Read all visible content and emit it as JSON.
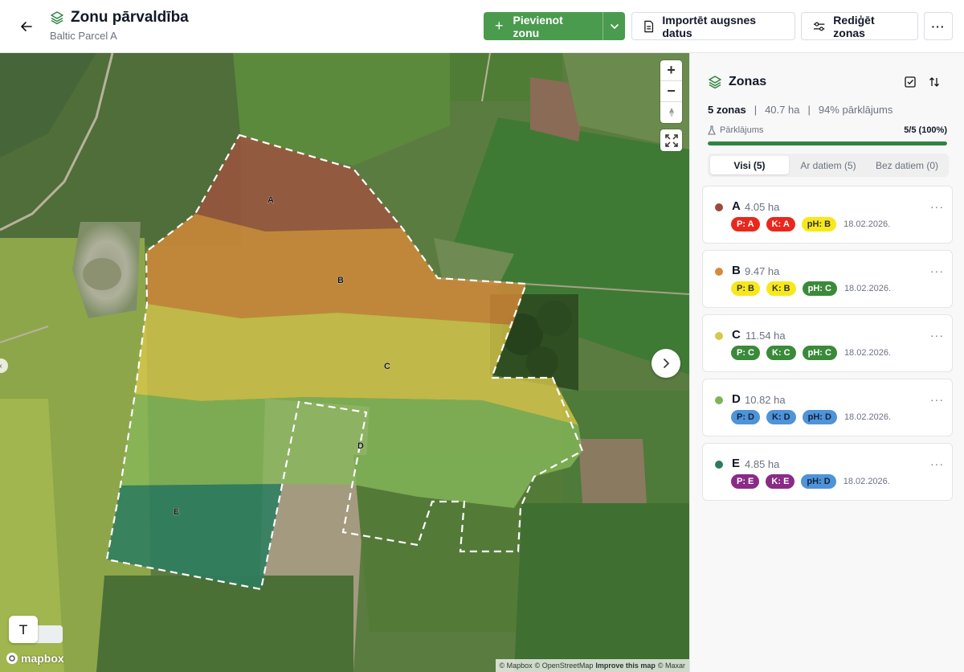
{
  "header": {
    "title": "Zonu pārvaldība",
    "subtitle": "Baltic Parcel A",
    "add_zone_label": "Pievienot zonu",
    "import_label": "Importēt augsnes datus",
    "edit_label": "Rediģēt zonas",
    "more_label": "···"
  },
  "map": {
    "zone_labels": [
      "A",
      "B",
      "C",
      "D",
      "E"
    ],
    "zoom_in": "+",
    "zoom_out": "−",
    "text_tool": "T",
    "logo": "mapbox",
    "attribution": {
      "mapbox": "© Mapbox",
      "osm": "© OpenStreetMap",
      "improve": "Improve this map",
      "maxar": "© Maxar"
    }
  },
  "panel": {
    "title": "Zonas",
    "zone_count": "5 zonas",
    "separator": "|",
    "total_area": "40.7 ha",
    "coverage_text": "94% pārklājums",
    "coverage_label": "Pārklājums",
    "coverage_value": "5/5 (100%)",
    "coverage_fraction": 1.0,
    "tabs": [
      "Visi (5)",
      "Ar datiem (5)",
      "Bez datiem (0)"
    ],
    "active_tab": 0
  },
  "zones": [
    {
      "letter": "A",
      "area": "4.05 ha",
      "color": "#9b4a3a",
      "date": "18.02.2026.",
      "badges": [
        {
          "text": "P: A",
          "bg": "#e8281e",
          "fg": "#ffffff"
        },
        {
          "text": "K: A",
          "bg": "#e8281e",
          "fg": "#ffffff"
        },
        {
          "text": "pH: B",
          "bg": "#f7e81c",
          "fg": "#333333"
        }
      ]
    },
    {
      "letter": "B",
      "area": "9.47 ha",
      "color": "#d68a3c",
      "date": "18.02.2026.",
      "badges": [
        {
          "text": "P: B",
          "bg": "#f7e81c",
          "fg": "#333333"
        },
        {
          "text": "K: B",
          "bg": "#f7e81c",
          "fg": "#333333"
        },
        {
          "text": "pH: C",
          "bg": "#3a8a3a",
          "fg": "#ffffff"
        }
      ]
    },
    {
      "letter": "C",
      "area": "11.54 ha",
      "color": "#d4c94e",
      "date": "18.02.2026.",
      "badges": [
        {
          "text": "P: C",
          "bg": "#3a8a3a",
          "fg": "#ffffff"
        },
        {
          "text": "K: C",
          "bg": "#3a8a3a",
          "fg": "#ffffff"
        },
        {
          "text": "pH: C",
          "bg": "#3a8a3a",
          "fg": "#ffffff"
        }
      ]
    },
    {
      "letter": "D",
      "area": "10.82 ha",
      "color": "#7fb35a",
      "date": "18.02.2026.",
      "badges": [
        {
          "text": "P: D",
          "bg": "#4f93d8",
          "fg": "#10243d"
        },
        {
          "text": "K: D",
          "bg": "#4f93d8",
          "fg": "#10243d"
        },
        {
          "text": "pH: D",
          "bg": "#4f93d8",
          "fg": "#10243d"
        }
      ]
    },
    {
      "letter": "E",
      "area": "4.85 ha",
      "color": "#2e7a5e",
      "date": "18.02.2026.",
      "badges": [
        {
          "text": "P: E",
          "bg": "#8a2b86",
          "fg": "#ffffff"
        },
        {
          "text": "K: E",
          "bg": "#8a2b86",
          "fg": "#ffffff"
        },
        {
          "text": "pH: D",
          "bg": "#4f93d8",
          "fg": "#10243d"
        }
      ]
    }
  ]
}
